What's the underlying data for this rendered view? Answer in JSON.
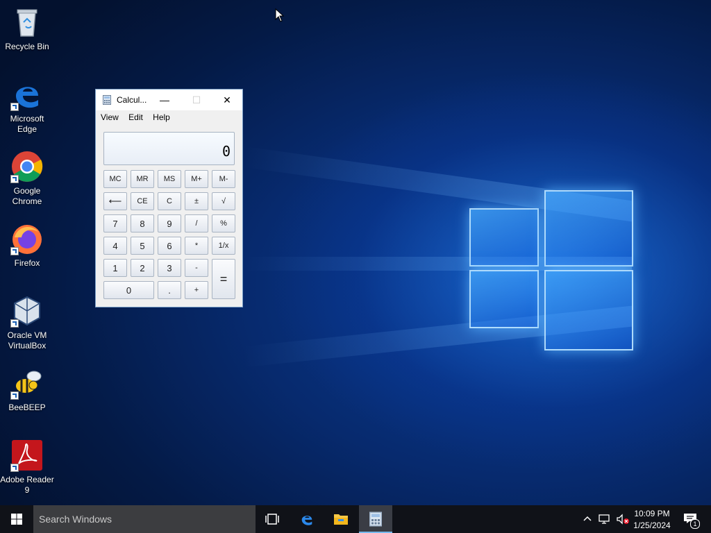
{
  "desktop": {
    "icons": [
      {
        "label": "Recycle Bin"
      },
      {
        "label": "Microsoft Edge"
      },
      {
        "label": "Google Chrome"
      },
      {
        "label": "Firefox"
      },
      {
        "label": "Oracle VM VirtualBox"
      },
      {
        "label": "BeeBEEP"
      },
      {
        "label": "Adobe Reader 9"
      }
    ]
  },
  "calculator": {
    "title": "Calcul...",
    "menu": [
      "View",
      "Edit",
      "Help"
    ],
    "display_value": "0",
    "buttons": {
      "mc": "MC",
      "mr": "MR",
      "ms": "MS",
      "mplus": "M+",
      "mminus": "M-",
      "back": "⟵",
      "ce": "CE",
      "c": "C",
      "plusminus": "±",
      "sqrt": "√",
      "n7": "7",
      "n8": "8",
      "n9": "9",
      "div": "/",
      "pct": "%",
      "n4": "4",
      "n5": "5",
      "n6": "6",
      "mul": "*",
      "inv": "1/x",
      "n1": "1",
      "n2": "2",
      "n3": "3",
      "sub": "-",
      "eq": "=",
      "n0": "0",
      "dot": ".",
      "add": "+"
    }
  },
  "taskbar": {
    "search_placeholder": "Search Windows",
    "time": "10:09 PM",
    "date": "1/25/2024",
    "notification_count": "1"
  },
  "colors": {
    "accent": "#0078d7",
    "taskbar": "#101218",
    "search": "#3c3d40"
  }
}
